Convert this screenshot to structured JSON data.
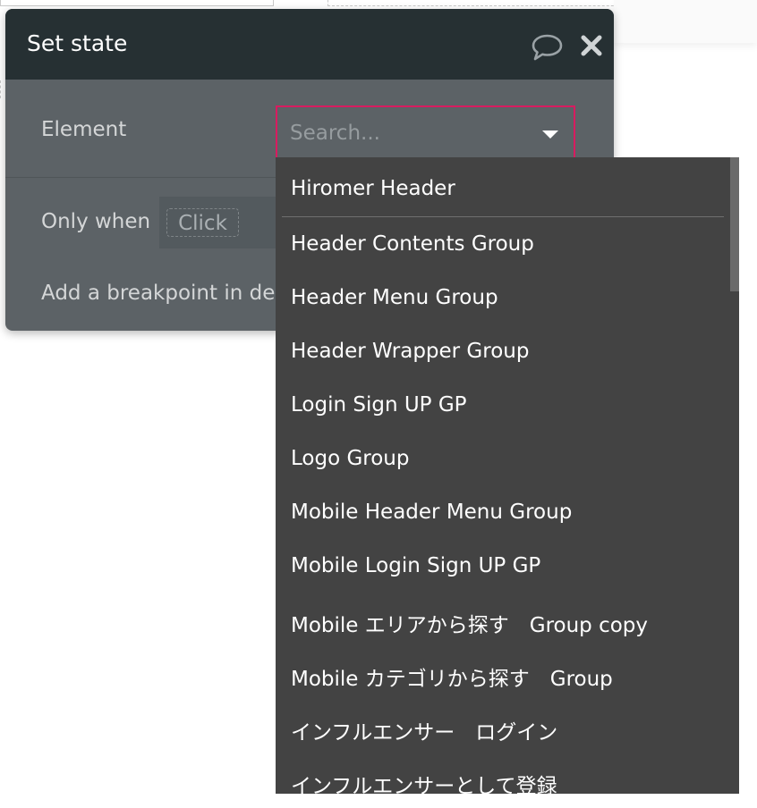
{
  "dialog": {
    "title": "Set state",
    "icons": {
      "comment": "comment-bubble-icon",
      "close": "close-icon"
    }
  },
  "element_row": {
    "label": "Element",
    "search": {
      "placeholder": "Search...",
      "value": ""
    }
  },
  "condition_row": {
    "label": "Only when",
    "chip": "Click"
  },
  "breakpoint_row": {
    "label": "Add a breakpoint in deb"
  },
  "dropdown": {
    "items": [
      "Hiromer Header",
      "Header Contents Group",
      "Header Menu Group",
      "Header Wrapper Group",
      "Login Sign UP GP",
      "Logo Group",
      "Mobile Header Menu Group",
      "Mobile Login Sign UP GP",
      "Mobile エリアから探す　Group copy",
      "Mobile カテゴリから探す　Group",
      "インフルエンサー　ログイン",
      "インフルエンサーとして登録"
    ]
  },
  "colors": {
    "header_bg": "#263033",
    "panel_bg": "#5c6266",
    "dropdown_bg": "#434343",
    "focus_border": "#d81b60"
  }
}
